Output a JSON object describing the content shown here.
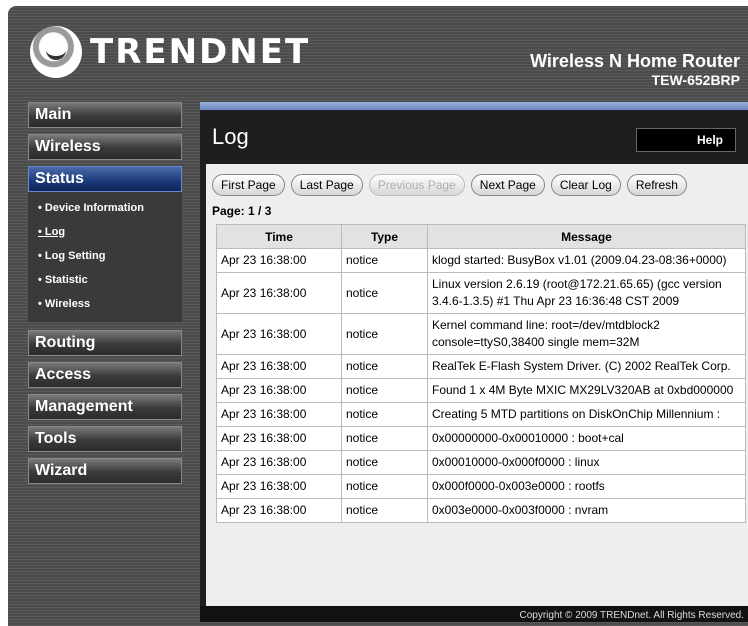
{
  "brand": {
    "logo_text": "TRENDNET",
    "product_name": "Wireless N Home Router",
    "model": "TEW-652BRP"
  },
  "nav": {
    "main": "Main",
    "wireless": "Wireless",
    "status": "Status",
    "status_sub": [
      "Device Information",
      "Log",
      "Log Setting",
      "Statistic",
      "Wireless"
    ],
    "routing": "Routing",
    "access": "Access",
    "management": "Management",
    "tools": "Tools",
    "wizard": "Wizard"
  },
  "page": {
    "title": "Log",
    "help": "Help",
    "buttons": {
      "first": "First Page",
      "last": "Last Page",
      "previous": "Previous Page",
      "next": "Next Page",
      "clear": "Clear Log",
      "refresh": "Refresh"
    },
    "page_label": "Page: 1 / 3"
  },
  "table": {
    "headers": [
      "Time",
      "Type",
      "Message"
    ],
    "rows": [
      [
        "Apr 23 16:38:00",
        "notice",
        "klogd started: BusyBox v1.01 (2009.04.23-08:36+0000)"
      ],
      [
        "Apr 23 16:38:00",
        "notice",
        "Linux version 2.6.19 (root@172.21.65.65) (gcc version 3.4.6-1.3.5) #1 Thu Apr 23 16:36:48 CST 2009"
      ],
      [
        "Apr 23 16:38:00",
        "notice",
        "Kernel command line: root=/dev/mtdblock2 console=ttyS0,38400 single mem=32M"
      ],
      [
        "Apr 23 16:38:00",
        "notice",
        "RealTek E-Flash System Driver. (C) 2002 RealTek Corp."
      ],
      [
        "Apr 23 16:38:00",
        "notice",
        "Found 1 x 4M Byte MXIC MX29LV320AB at 0xbd000000"
      ],
      [
        "Apr 23 16:38:00",
        "notice",
        "Creating 5 MTD partitions on DiskOnChip Millennium :"
      ],
      [
        "Apr 23 16:38:00",
        "notice",
        "0x00000000-0x00010000 : boot+cal"
      ],
      [
        "Apr 23 16:38:00",
        "notice",
        "0x00010000-0x000f0000 : linux"
      ],
      [
        "Apr 23 16:38:00",
        "notice",
        "0x000f0000-0x003e0000 : rootfs"
      ],
      [
        "Apr 23 16:38:00",
        "notice",
        "0x003e0000-0x003f0000 : nvram"
      ]
    ]
  },
  "footer": {
    "copyright": "Copyright © 2009 TRENDnet. All Rights Reserved."
  }
}
